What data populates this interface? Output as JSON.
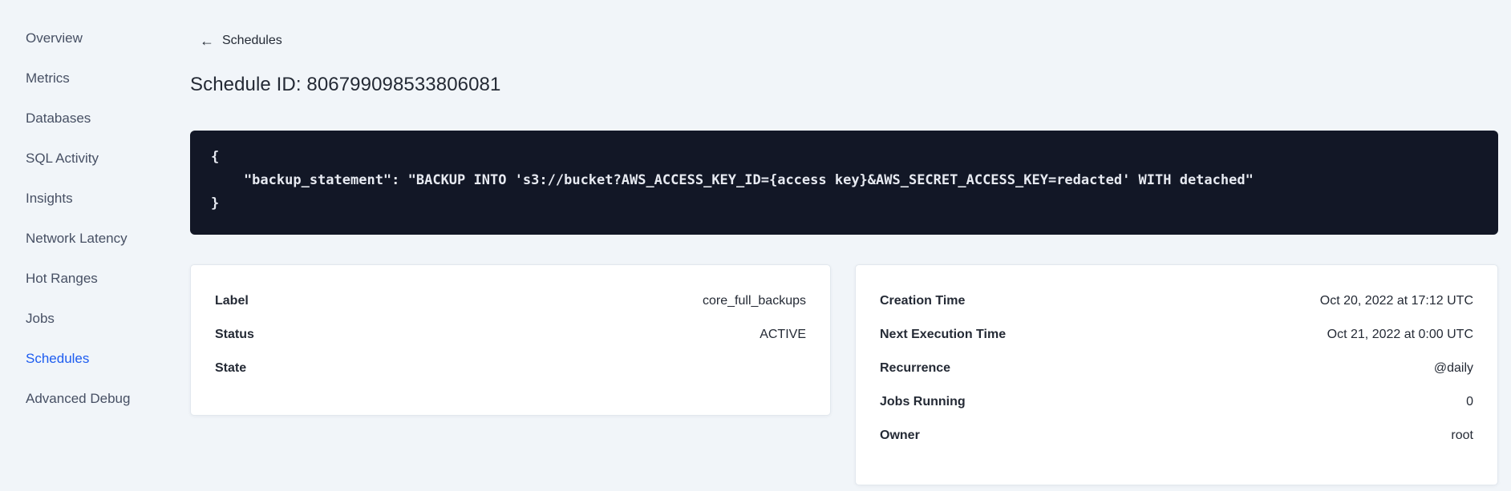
{
  "sidebar": {
    "items": [
      {
        "label": "Overview",
        "active": false
      },
      {
        "label": "Metrics",
        "active": false
      },
      {
        "label": "Databases",
        "active": false
      },
      {
        "label": "SQL Activity",
        "active": false
      },
      {
        "label": "Insights",
        "active": false
      },
      {
        "label": "Network Latency",
        "active": false
      },
      {
        "label": "Hot Ranges",
        "active": false
      },
      {
        "label": "Jobs",
        "active": false
      },
      {
        "label": "Schedules",
        "active": true
      },
      {
        "label": "Advanced Debug",
        "active": false
      }
    ]
  },
  "header": {
    "back_icon": "←",
    "back_label": "Schedules",
    "title": "Schedule ID: 806799098533806081"
  },
  "code_block": {
    "lines": [
      "{",
      "    \"backup_statement\": \"BACKUP INTO 's3://bucket?AWS_ACCESS_KEY_ID={access key}&AWS_SECRET_ACCESS_KEY=redacted' WITH detached\"",
      "}"
    ]
  },
  "details_card": {
    "rows": [
      {
        "label": "Label",
        "value": "core_full_backups"
      },
      {
        "label": "Status",
        "value": "ACTIVE"
      },
      {
        "label": "State",
        "value": ""
      }
    ]
  },
  "timing_card": {
    "rows": [
      {
        "label": "Creation Time",
        "value": "Oct 20, 2022 at 17:12 UTC"
      },
      {
        "label": "Next Execution Time",
        "value": "Oct 21, 2022 at 0:00 UTC"
      },
      {
        "label": "Recurrence",
        "value": "@daily"
      },
      {
        "label": "Jobs Running",
        "value": "0"
      },
      {
        "label": "Owner",
        "value": "root"
      }
    ]
  },
  "colors": {
    "accent_blue": "#1d5cf0",
    "code_bg": "#121726",
    "page_bg": "#f1f5f9",
    "text_dark": "#242a35"
  }
}
